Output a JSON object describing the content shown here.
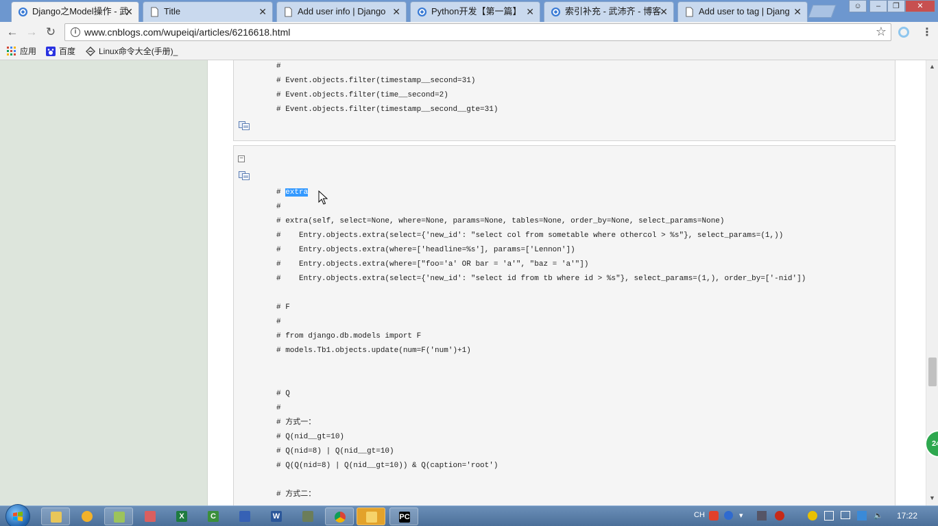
{
  "browser": {
    "tabs": [
      {
        "label": "Django之Model操作 - 武",
        "icon": "cnblogs-icon",
        "active": true
      },
      {
        "label": "Title",
        "icon": "page-icon",
        "active": false
      },
      {
        "label": "Add user info | Django",
        "icon": "page-icon",
        "active": false
      },
      {
        "label": "Python开发【第一篇】",
        "icon": "cnblogs-icon",
        "active": false
      },
      {
        "label": "索引补充 - 武沛齐 - 博客",
        "icon": "cnblogs-icon",
        "active": false
      },
      {
        "label": "Add user to tag | Djang",
        "icon": "page-icon",
        "active": false
      }
    ],
    "tab_close": "✕",
    "url": "www.cnblogs.com/wupeiqi/articles/6216618.html",
    "bookmarks": [
      {
        "label": "应用",
        "icon": "apps-grid-icon"
      },
      {
        "label": "百度",
        "icon": "baidu-paw-icon"
      },
      {
        "label": "Linux命令大全(手册)_",
        "icon": "linux-cmd-icon"
      }
    ]
  },
  "code_blocks": {
    "block1": {
      "lines": [
        "#",
        "# Event.objects.filter(timestamp__second=31)",
        "# Event.objects.filter(time__second=2)",
        "# Event.objects.filter(timestamp__second__gte=31)"
      ]
    },
    "block2": {
      "collapse_symbol": "−",
      "lines": [
        {
          "pre": "# ",
          "highlight": "extra",
          "post": ""
        },
        {
          "text": "#"
        },
        {
          "text": "# extra(self, select=None, where=None, params=None, tables=None, order_by=None, select_params=None)"
        },
        {
          "text": "#    Entry.objects.extra(select={'new_id': \"select col from sometable where othercol > %s\"}, select_params=(1,))"
        },
        {
          "text": "#    Entry.objects.extra(where=['headline=%s'], params=['Lennon'])"
        },
        {
          "text": "#    Entry.objects.extra(where=[\"foo='a' OR bar = 'a'\", \"baz = 'a'\"])"
        },
        {
          "text": "#    Entry.objects.extra(select={'new_id': \"select id from tb where id > %s\"}, select_params=(1,), order_by=['-nid'])"
        },
        {
          "text": "# F"
        },
        {
          "text": "#"
        },
        {
          "text": "# from django.db.models import F"
        },
        {
          "text": "# models.Tb1.objects.update(num=F('num')+1)"
        },
        {
          "text": "# Q"
        },
        {
          "text": "#"
        },
        {
          "text": "# 方式一："
        },
        {
          "text": "# Q(nid__gt=10)"
        },
        {
          "text": "# Q(nid=8) | Q(nid__gt=10)"
        },
        {
          "text": "# Q(Q(nid=8) | Q(nid__gt=10)) & Q(caption='root')"
        },
        {
          "text": "# 方式二："
        }
      ]
    }
  },
  "floating_badge": "24",
  "taskbar": {
    "apps": [
      "explorer",
      "chrome-like",
      "notepad",
      "paint",
      "excel",
      "c-app",
      "save-app",
      "word",
      "tool",
      "chrome",
      "audio",
      "pycharm"
    ],
    "tray": {
      "ime": "CH",
      "time": "17:22"
    }
  }
}
